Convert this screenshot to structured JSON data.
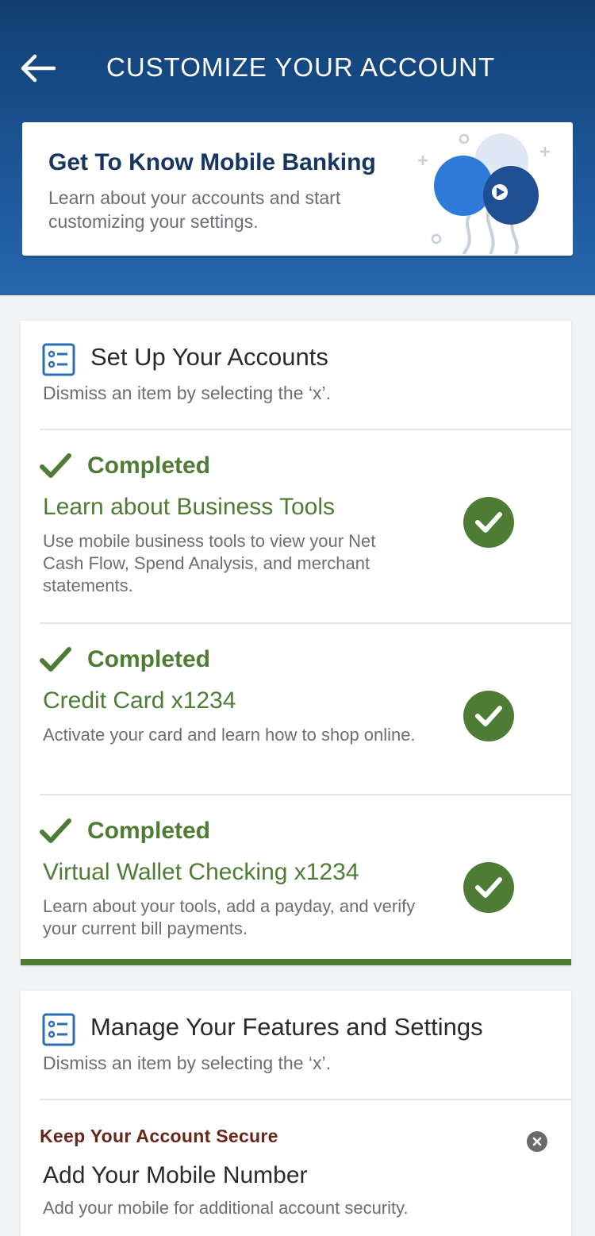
{
  "header": {
    "title": "CUSTOMIZE YOUR ACCOUNT",
    "back_icon": "arrow-left-icon"
  },
  "hero": {
    "title": "Get To Know Mobile Banking",
    "description": "Learn about your accounts and start customizing your settings.",
    "illustration": "balloons-illustration"
  },
  "setup": {
    "title": "Set Up Your Accounts",
    "subtitle": "Dismiss an item by selecting the ‘x’.",
    "items": [
      {
        "status": "Completed",
        "title": "Learn about Business Tools",
        "description": "Use mobile business tools to view your Net Cash Flow, Spend Analysis, and merchant statements."
      },
      {
        "status": "Completed",
        "title": "Credit Card x1234",
        "description": "Activate your card and learn how to shop online."
      },
      {
        "status": "Completed",
        "title": "Virtual Wallet Checking x1234",
        "description": "Learn about your tools, add a payday, and verify your current bill payments."
      }
    ]
  },
  "features": {
    "title": "Manage Your Features and Settings",
    "subtitle": "Dismiss an item by selecting the ‘x’.",
    "items": [
      {
        "label": "Keep Your Account Secure",
        "title": "Add Your Mobile Number",
        "description": "Add your mobile for additional account security."
      }
    ]
  },
  "colors": {
    "header_dark": "#123f72",
    "header_light": "#2766ad",
    "success_green": "#4f7c34",
    "alert_red": "#6b2418",
    "title_navy": "#163660"
  }
}
